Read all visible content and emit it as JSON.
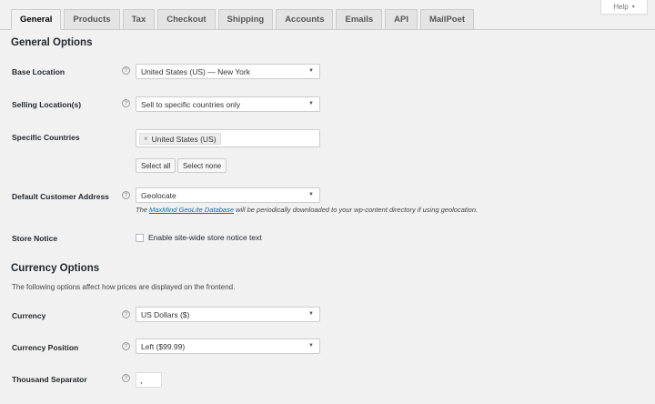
{
  "help": {
    "label": "Help",
    "caret": "▾"
  },
  "tabs": [
    "General",
    "Products",
    "Tax",
    "Checkout",
    "Shipping",
    "Accounts",
    "Emails",
    "API",
    "MailPoet"
  ],
  "general_options": {
    "heading": "General Options",
    "base_location": {
      "label": "Base Location",
      "value": "United States (US) — New York"
    },
    "selling_locations": {
      "label": "Selling Location(s)",
      "value": "Sell to specific countries only"
    },
    "specific_countries": {
      "label": "Specific Countries",
      "chip": "United States (US)",
      "select_all": "Select all",
      "select_none": "Select none"
    },
    "default_customer_address": {
      "label": "Default Customer Address",
      "value": "Geolocate",
      "desc_prefix": "The",
      "desc_link": "MaxMind GeoLite Database",
      "desc_suffix": "will be periodically downloaded to your wp-content directory if using geolocation."
    },
    "store_notice": {
      "label": "Store Notice",
      "checkbox_label": "Enable site-wide store notice text"
    }
  },
  "currency_options": {
    "heading": "Currency Options",
    "description": "The following options affect how prices are displayed on the frontend.",
    "currency": {
      "label": "Currency",
      "value": "US Dollars ($)"
    },
    "currency_position": {
      "label": "Currency Position",
      "value": "Left ($99.99)"
    },
    "thousand_separator": {
      "label": "Thousand Separator",
      "value": ","
    }
  },
  "icons": {
    "help_icon": "?",
    "dropdown_arrow": "▼",
    "remove_icon": "×"
  }
}
